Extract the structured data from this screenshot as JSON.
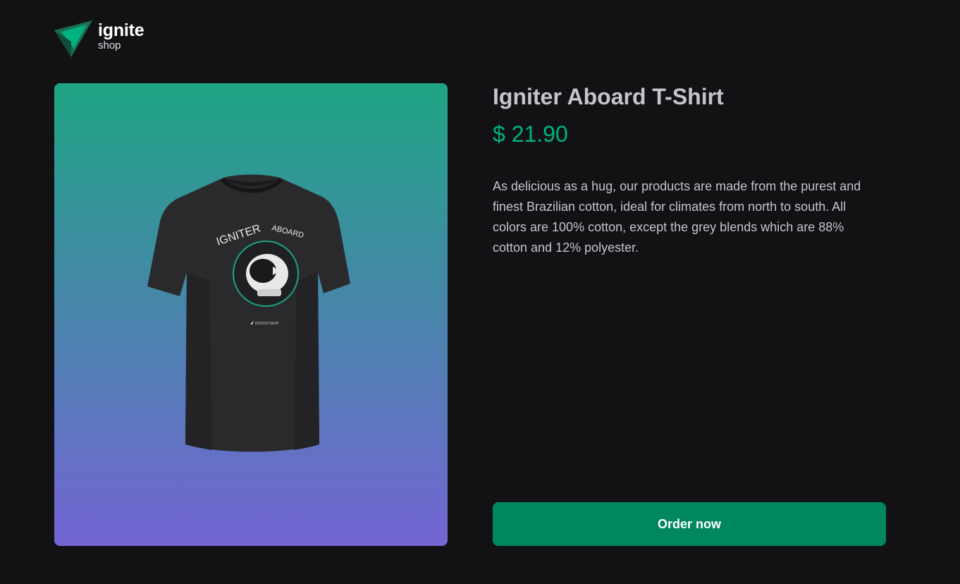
{
  "header": {
    "logo_icon": "triangle-logo-icon",
    "logo_title": "ignite",
    "logo_subtitle": "shop"
  },
  "product": {
    "image_alt": "Igniter Aboard T-Shirt",
    "title": "Igniter Aboard T-Shirt",
    "price": "$ 21.90",
    "description": "As delicious as a hug, our products are made from the purest and finest Brazilian cotton, ideal for climates from north to south. All colors are 100% cotton, except the grey blends which are 88% cotton and 12% polyester.",
    "order_button_label": "Order now"
  },
  "colors": {
    "background": "#121214",
    "brand_green": "#00875f",
    "price_green": "#00b37e",
    "gradient_top": "#1ea483",
    "gradient_bottom": "#7465d4",
    "title_text": "#c4c4cc"
  }
}
